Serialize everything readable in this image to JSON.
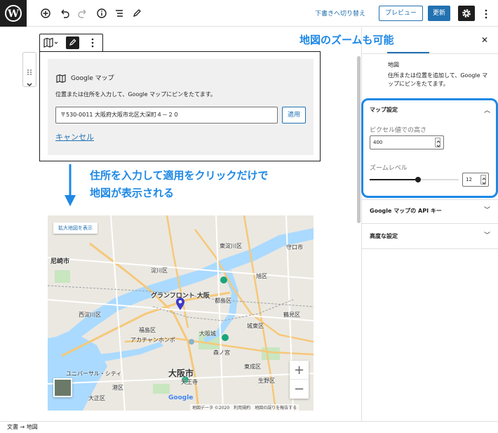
{
  "toolbar": {
    "draft_switch": "下書きへ切り替え",
    "preview": "プレビュー",
    "update": "更新"
  },
  "block": {
    "title": "Google マップ",
    "instructions": "位置または住所を入力して、Google マップにピンをたてます。",
    "address_value": "〒530-0011 大阪府大阪市北区大深町４－２０",
    "apply": "適用",
    "cancel": "キャンセル"
  },
  "annotations": {
    "zoom_note": "地図のズームも可能",
    "apply_note_line1": "住所を入力して適用をクリックだけで",
    "apply_note_line2": "地図が表示される"
  },
  "map": {
    "enlarge": "拡大地図を表示",
    "labels": {
      "amagasaki": "尼崎市",
      "higashiyodogawa": "東淀川区",
      "moriguchi": "守口市",
      "yodogawa": "淀川区",
      "asahi": "旭区",
      "grandfront": "グランフロント 大阪",
      "miyakojima": "都島区",
      "nishiyodogawa": "西淀川区",
      "fukushima": "福島区",
      "joto": "城東区",
      "tsurumi": "鶴見区",
      "acanthus": "アカチャンホンポ",
      "osakajo": "大阪城",
      "morinomiya": "森ノ宮",
      "osakashi": "大阪市",
      "higashinari": "東成区",
      "tennoji_ward": "天王寺",
      "ikuno": "生野区",
      "minato": "港区",
      "taisho": "大正区",
      "universal": "ユニバーサル・シティ"
    },
    "google": "Google",
    "attribution": "地図データ ©2020　利用規約　地図の誤りを報告する"
  },
  "sidebar": {
    "block_name": "地図",
    "block_desc": "住所または位置を追加して、Google マップにピンをたてます。",
    "panel_map_settings": "マップ設定",
    "pixel_height_label": "ピクセル値での高さ",
    "height_value": "400",
    "zoom_label": "ズームレベル",
    "zoom_value": "12",
    "panel_api_key": "Google マップの API キー",
    "panel_advanced": "高度な設定"
  },
  "zoom_level": {
    "value": 12,
    "min": 0,
    "max": 22
  },
  "breadcrumb": "文書 → 地図"
}
